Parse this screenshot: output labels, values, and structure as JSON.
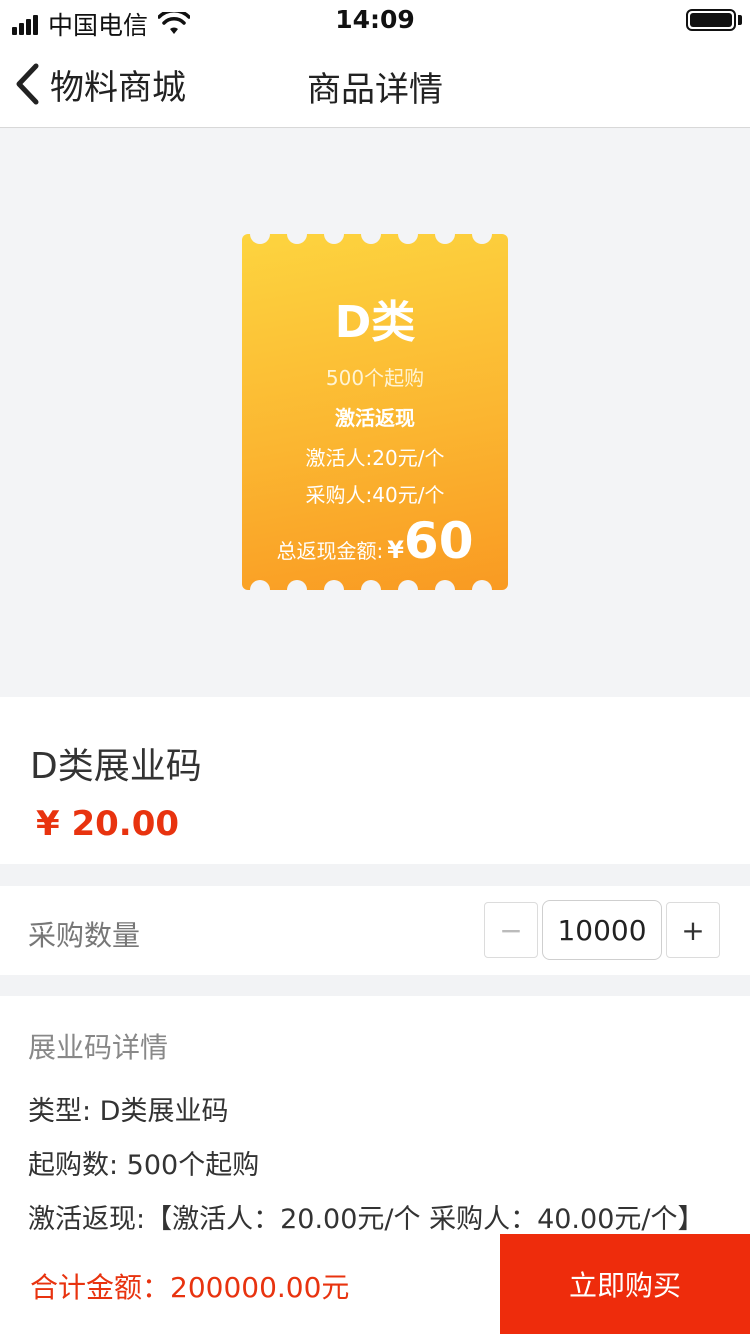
{
  "status_bar": {
    "carrier": "中国电信",
    "time": "14:09"
  },
  "nav": {
    "back_label": "物料商城",
    "title": "商品详情"
  },
  "ticket": {
    "title": "D类",
    "min_purchase": "500个起购",
    "mode": "激活返现",
    "activator": "激活人:20元/个",
    "purchaser": "采购人:40元/个",
    "total_label": "总返现金额:",
    "total_currency": "¥",
    "total_amount": "60"
  },
  "product": {
    "name": "D类展业码",
    "price": "¥ 20.00"
  },
  "quantity": {
    "label": "采购数量",
    "minus": "−",
    "value": "10000",
    "plus": "+"
  },
  "details": {
    "title": "展业码详情",
    "type_line": "类型: D类展业码",
    "min_line": "起购数: 500个起购",
    "cashback_line": "激活返现:【激活人：20.00元/个 采购人：40.00元/个】"
  },
  "footer": {
    "total": "合计金额：200000.00元",
    "buy_label": "立即购买"
  },
  "colors": {
    "accent_red": "#ee2c0c",
    "price_red": "#e8330f",
    "ticket_yellow": "#fdd43f",
    "ticket_orange": "#f99a22"
  }
}
